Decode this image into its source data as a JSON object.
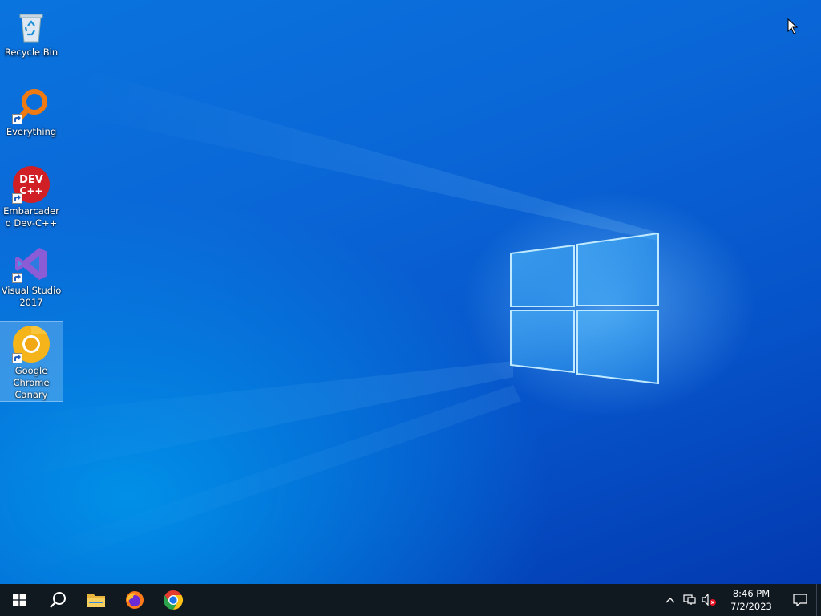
{
  "desktop": {
    "icons": [
      {
        "label": "Recycle Bin",
        "icon": "recycle-bin-icon",
        "shortcut": false
      },
      {
        "label": "Everything",
        "icon": "everything-search-icon",
        "shortcut": true
      },
      {
        "label": "Embarcadero Dev-C++",
        "icon": "dev-cpp-icon",
        "glyph_line1": "DEV",
        "glyph_line2": "C++",
        "shortcut": true
      },
      {
        "label": "Visual Studio 2017",
        "icon": "visual-studio-icon",
        "shortcut": true
      },
      {
        "label": "Google Chrome Canary",
        "icon": "chrome-canary-icon",
        "shortcut": true,
        "selected": true
      }
    ]
  },
  "taskbar": {
    "pinned": [
      {
        "name": "start",
        "icon": "windows-start-icon"
      },
      {
        "name": "search",
        "icon": "search-icon"
      },
      {
        "name": "file-explorer",
        "icon": "folder-icon"
      },
      {
        "name": "firefox",
        "icon": "firefox-icon"
      },
      {
        "name": "chrome",
        "icon": "chrome-icon"
      }
    ],
    "tray": {
      "icons": [
        "chevron-up-icon",
        "network-icon",
        "volume-muted-icon"
      ],
      "time": "8:46 PM",
      "date": "7/2/2023"
    }
  },
  "colors": {
    "taskbar": "#101820",
    "desktop_accent": "#0a66d6"
  }
}
